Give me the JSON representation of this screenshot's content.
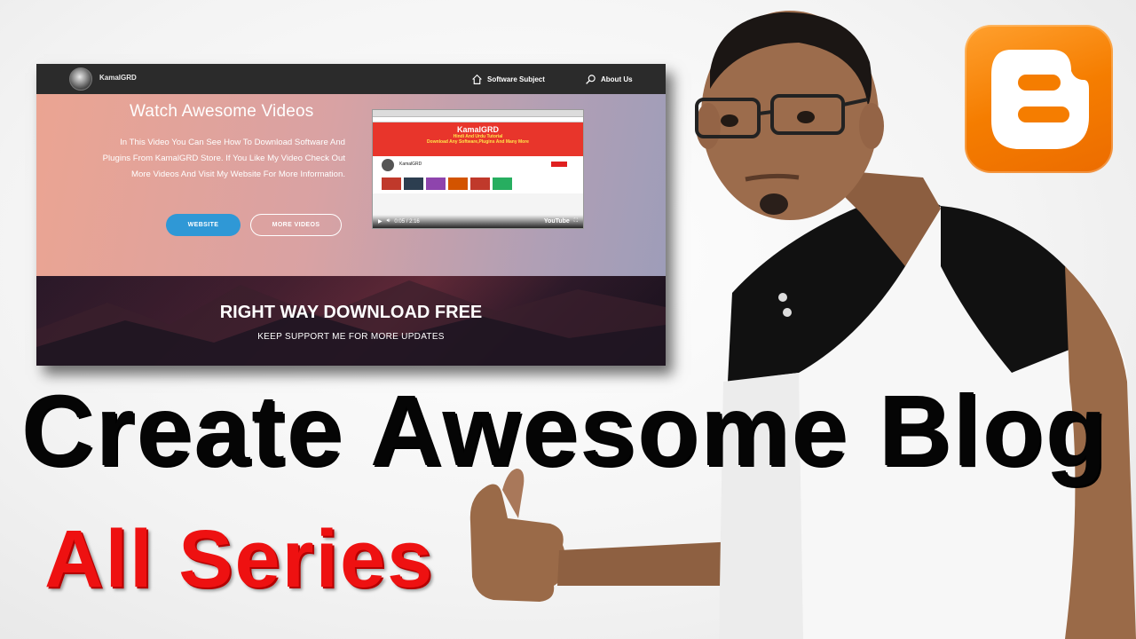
{
  "site": {
    "brand": "KamalGRD",
    "nav": [
      {
        "label": "Software Subject",
        "icon": "home-icon"
      },
      {
        "label": "About Us",
        "icon": "search-icon"
      }
    ]
  },
  "hero": {
    "title": "Watch Awesome Videos",
    "description": "In This Video You Can See How To Download Software And Plugins From KamalGRD Store. If You Like My Video Check Out More Videos And Visit My Website For More Information.",
    "buttons": {
      "website": "WEBSITE",
      "more_videos": "MORE VIDEOS"
    }
  },
  "video": {
    "banner_channel": "KamalGRD",
    "banner_line1": "Hindi And Urdu Tutorial",
    "banner_line2": "Download Any Software,Plugins And Many More",
    "channel_name": "KamalGRD",
    "time": "0:05 / 2:16",
    "player_brand": "YouTube"
  },
  "strip": {
    "title": "RIGHT WAY DOWNLOAD FREE",
    "subtitle": "KEEP SUPPORT ME FOR MORE UPDATES"
  },
  "headline": "Create Awesome Blog",
  "subline": "All Series",
  "colors": {
    "blogger_orange": "#f57d00",
    "subline_red": "#ee1111",
    "website_button": "#2f98d6",
    "navbar": "#2b2b2b"
  }
}
